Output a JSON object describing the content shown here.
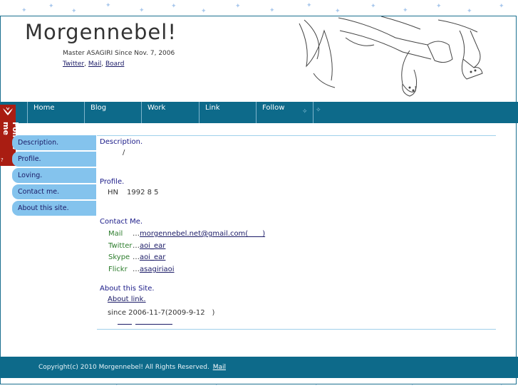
{
  "colors": {
    "accent": "#0d6a8a",
    "side_tab": "#84c3ed",
    "follow": "#a91d12",
    "link": "#1a1a66"
  },
  "header": {
    "title": "Morgennebel!",
    "tagline": "Master ASAGIRI Since Nov. 7, 2006",
    "links": [
      "Twitter",
      "Mail",
      "Board"
    ],
    "separator": ","
  },
  "nav": {
    "items": [
      "Home",
      "Blog",
      "Work",
      "Link",
      "Follow"
    ],
    "deco": "✧"
  },
  "follow_tab": {
    "label": "Follow me",
    "help": "?",
    "icon": "bird-icon"
  },
  "sidebar": {
    "items": [
      "Description.",
      "Profile.",
      "Loving.",
      "Contact me.",
      "About this site."
    ]
  },
  "main": {
    "description": {
      "heading": "Description.",
      "text": "/"
    },
    "profile": {
      "heading": "Profile.",
      "hn": "HN",
      "date": "1992 8 5"
    },
    "contact": {
      "heading": "Contact Me.",
      "rows": [
        {
          "label": "Mail",
          "ellipsis": "…",
          "value": "morgennebel.net@gmail.com(  )"
        },
        {
          "label": "Twitter",
          "ellipsis": "…",
          "value": "aoi_ear"
        },
        {
          "label": "Skype",
          "ellipsis": "…",
          "value": "aoi_ear"
        },
        {
          "label": "Flickr",
          "ellipsis": "…",
          "value": "asagiriaoi"
        }
      ]
    },
    "about": {
      "heading": "About this Site.",
      "link": "About link.",
      "since": "since 2006-11-7(2009-9-12　)"
    }
  },
  "footer": {
    "copyright": "Copyright(c) 2010 Morgennebel! All Rights Reserved.",
    "mail": "Mail"
  }
}
